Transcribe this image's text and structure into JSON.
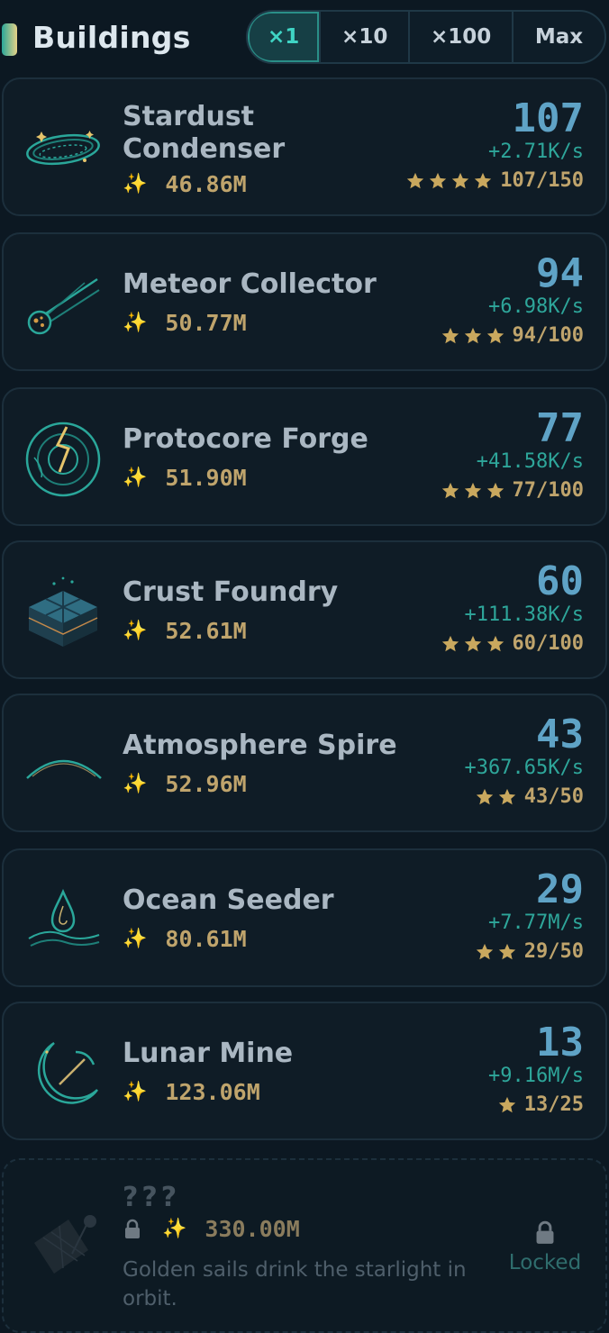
{
  "header": {
    "title": "Buildings",
    "multipliers": [
      "×1",
      "×10",
      "×100",
      "Max"
    ],
    "active_multiplier": "×1"
  },
  "colors": {
    "accent_teal": "#3fd4c4",
    "count_blue": "#5fa3c6",
    "gold": "#bfa46c",
    "rate_teal": "#2ea69a"
  },
  "buildings": [
    {
      "name_line1": "Stardust",
      "name_line2": "Condenser",
      "cost": "46.86M",
      "count": "107",
      "rate": "+2.71K/s",
      "stars": 4,
      "progress": "107/150",
      "icon": "stardust-ring-icon"
    },
    {
      "name_line1": "Meteor Collector",
      "name_line2": "",
      "cost": "50.77M",
      "count": "94",
      "rate": "+6.98K/s",
      "stars": 3,
      "progress": "94/100",
      "icon": "meteor-icon"
    },
    {
      "name_line1": "Protocore Forge",
      "name_line2": "",
      "cost": "51.90M",
      "count": "77",
      "rate": "+41.58K/s",
      "stars": 3,
      "progress": "77/100",
      "icon": "core-forge-icon"
    },
    {
      "name_line1": "Crust Foundry",
      "name_line2": "",
      "cost": "52.61M",
      "count": "60",
      "rate": "+111.38K/s",
      "stars": 3,
      "progress": "60/100",
      "icon": "crust-cube-icon"
    },
    {
      "name_line1": "Atmosphere Spire",
      "name_line2": "",
      "cost": "52.96M",
      "count": "43",
      "rate": "+367.65K/s",
      "stars": 2,
      "progress": "43/50",
      "icon": "atmosphere-arc-icon"
    },
    {
      "name_line1": "Ocean Seeder",
      "name_line2": "",
      "cost": "80.61M",
      "count": "29",
      "rate": "+7.77M/s",
      "stars": 2,
      "progress": "29/50",
      "icon": "water-drop-icon"
    },
    {
      "name_line1": "Lunar Mine",
      "name_line2": "",
      "cost": "123.06M",
      "count": "13",
      "rate": "+9.16M/s",
      "stars": 1,
      "progress": "13/25",
      "icon": "moon-pickaxe-icon"
    }
  ],
  "locked": {
    "name": "???",
    "cost": "330.00M",
    "description": "Golden sails drink the starlight in orbit.",
    "status": "Locked",
    "icon": "solar-sail-icon"
  },
  "sparkle_glyph": "✨"
}
